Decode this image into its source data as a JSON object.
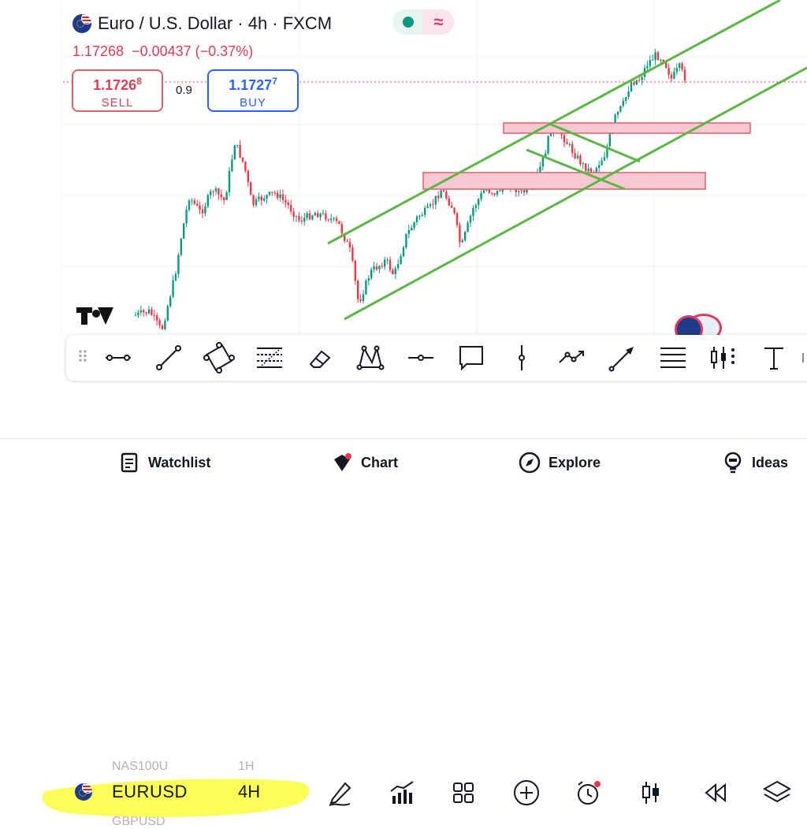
{
  "header": {
    "title": "Euro / U.S. Dollar · 4h · FXCM",
    "price": "1.17268",
    "change": "−0.00437",
    "change_pct": "(−0.37%)"
  },
  "trade": {
    "sell_price_main": "1.1726",
    "sell_price_pip": "8",
    "sell_label": "SELL",
    "spread": "0.9",
    "buy_price_main": "1.1727",
    "buy_price_pip": "7",
    "buy_label": "BUY"
  },
  "colors": {
    "up": "#089981",
    "down": "#f23645",
    "trendline": "#5cb646",
    "zone_fill": "#f8c8d2",
    "zone_border": "#e35d6a",
    "highlight": "#fbff3a",
    "buy": "#2962ff",
    "sell": "#e03c50"
  },
  "drawing_tools": [
    "grip-icon",
    "horizontal-line-icon",
    "trend-line-icon",
    "rotated-rectangle-icon",
    "fib-retracement-icon",
    "eraser-icon",
    "xabcd-pattern-icon",
    "horizontal-ray-icon",
    "callout-icon",
    "vertical-line-icon",
    "path-icon",
    "arrow-icon",
    "parallel-lines-icon",
    "long-position-icon",
    "text-icon",
    "more-icon"
  ],
  "symbol_bar": {
    "symbol": "EURUSD",
    "timeframe": "4H",
    "ghost_above": "NAS100U",
    "ghost_above_tf": "1H",
    "ghost_below": "GBPUSD",
    "buttons": [
      "pen-icon",
      "indicators-icon",
      "grid-icon",
      "add-icon",
      "alarm-icon",
      "candlestick-icon",
      "replay-icon",
      "layers-icon"
    ]
  },
  "nav": [
    {
      "label": "Watchlist",
      "icon": "watchlist-icon"
    },
    {
      "label": "Chart",
      "icon": "chart-icon"
    },
    {
      "label": "Explore",
      "icon": "compass-icon"
    },
    {
      "label": "Ideas",
      "icon": "ideas-icon"
    }
  ]
}
